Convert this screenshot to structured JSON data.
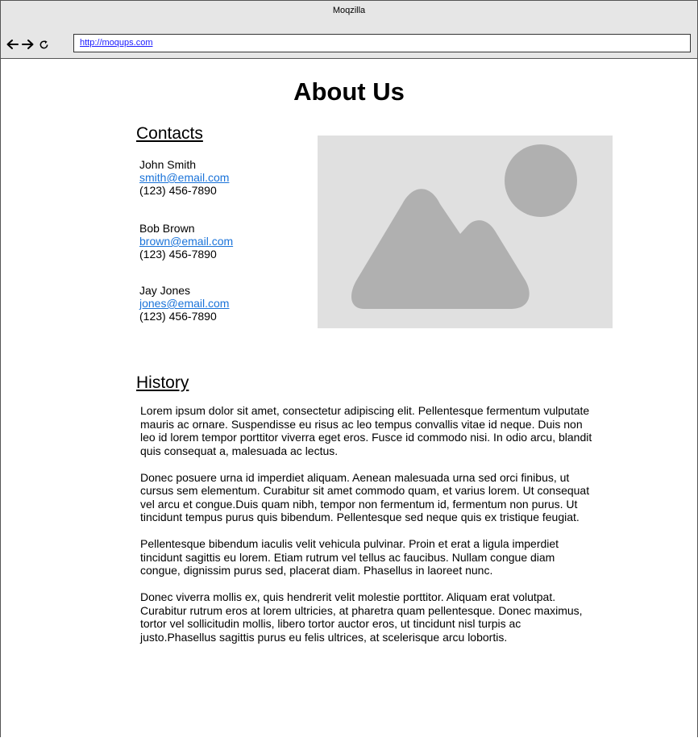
{
  "window": {
    "title": "Moqzilla",
    "url": "http://moqups.com"
  },
  "toolbar": {
    "back_icon": "arrow-left-icon",
    "forward_icon": "arrow-right-icon",
    "reload_icon": "reload-icon"
  },
  "page": {
    "title": "About Us",
    "contacts_heading": "Contacts",
    "contacts": [
      {
        "name": "John Smith",
        "email": "smith@email.com",
        "phone": "(123) 456-7890"
      },
      {
        "name": "Bob Brown",
        "email": "brown@email.com",
        "phone": "(123) 456-7890"
      },
      {
        "name": "Jay Jones",
        "email": "jones@email.com",
        "phone": "(123) 456-7890"
      }
    ],
    "image_icon": "image-placeholder-icon",
    "history_heading": "History",
    "history_paragraphs": [
      "Lorem ipsum dolor sit amet, consectetur adipiscing elit. Pellentesque fermentum vulputate mauris ac ornare. Suspendisse eu risus ac leo tempus convallis vitae id neque. Duis non leo id lorem tempor porttitor viverra eget eros. Fusce id commodo nisi. In odio arcu, blandit quis consequat a, malesuada ac lectus.",
      "Donec posuere urna id imperdiet aliquam. Aenean malesuada urna sed orci finibus, ut cursus sem elementum. Curabitur sit amet commodo quam, et varius lorem. Ut consequat vel arcu et congue.Duis quam nibh, tempor non fermentum id, fermentum non purus. Ut tincidunt tempus purus quis bibendum. Pellentesque sed neque quis ex tristique feugiat.",
      "Pellentesque bibendum iaculis velit vehicula pulvinar. Proin et erat a ligula imperdiet tincidunt sagittis eu lorem. Etiam rutrum vel tellus ac faucibus. Nullam congue diam congue, dignissim purus sed, placerat diam. Phasellus in laoreet nunc.",
      "Donec viverra mollis ex, quis hendrerit velit molestie porttitor. Aliquam erat volutpat. Curabitur rutrum eros at lorem ultricies, at pharetra quam pellentesque. Donec maximus, tortor vel sollicitudin mollis, libero tortor auctor eros, ut tincidunt nisl turpis ac justo.Phasellus sagittis purus eu felis ultrices, at scelerisque arcu lobortis."
    ]
  },
  "colors": {
    "chrome": "#e6e6e6",
    "link": "#1a73d9",
    "placeholder_bg": "#e0e0e0",
    "placeholder_shape": "#b0b0b0"
  }
}
